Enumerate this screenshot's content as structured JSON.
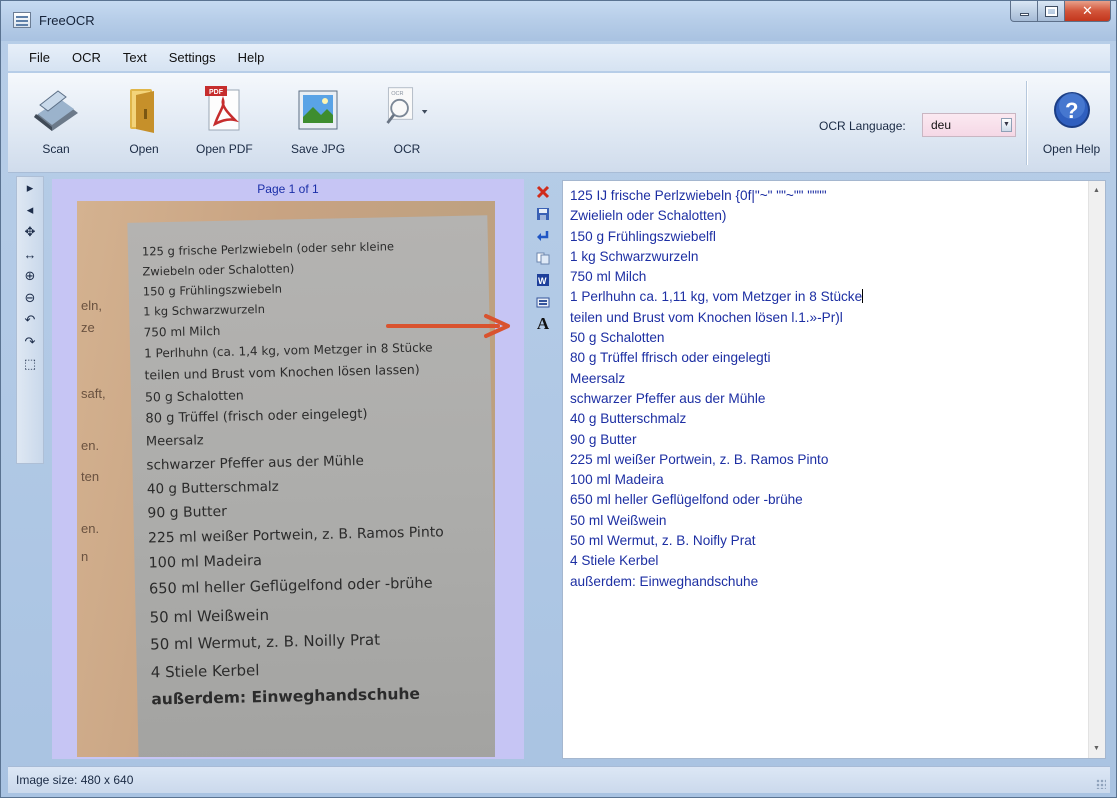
{
  "window": {
    "title": "FreeOCR"
  },
  "menu": {
    "items": [
      "File",
      "OCR",
      "Text",
      "Settings",
      "Help"
    ]
  },
  "toolbar": {
    "scan_label": "Scan",
    "open_label": "Open",
    "open_pdf_label": "Open PDF",
    "save_jpg_label": "Save JPG",
    "ocr_label": "OCR",
    "ocr_language_label": "OCR Language:",
    "ocr_language_value": "deu",
    "open_help_label": "Open Help"
  },
  "image_panel": {
    "page_label": "Page 1 of 1",
    "left_edge_text": [
      "eln,",
      "ze",
      "saft,",
      "en.",
      "ten",
      "en.",
      "n"
    ],
    "recipe_lines": [
      "125 g frische Perlzwiebeln (oder sehr kleine",
      "Zwiebeln oder Schalotten)",
      "150 g Frühlingszwiebeln",
      "1 kg Schwarzwurzeln",
      "750 ml Milch",
      "1 Perlhuhn (ca. 1,4 kg, vom Metzger in 8 Stücke",
      "teilen und Brust vom Knochen lösen lassen)",
      "50 g Schalotten",
      "80 g Trüffel (frisch oder eingelegt)",
      "Meersalz",
      "schwarzer Pfeffer aus der Mühle",
      "40 g Butterschmalz",
      "90 g Butter",
      "225 ml weißer Portwein, z. B. Ramos Pinto",
      "100 ml Madeira",
      "650 ml heller Geflügelfond oder -brühe",
      "50 ml Weißwein",
      "50 ml Wermut, z. B. Noilly Prat",
      "4 Stiele Kerbel",
      "außerdem: Einweghandschuhe"
    ]
  },
  "ocr_text": {
    "lines": [
      "125 IJ frische Perlzwiebeln {0f|\"~\" \"\"~\"\" \"\"\"\"",
      "Zwielieln oder Schalotten)",
      "150 g Frühlingszwiebelfl",
      "1 kg Schwarzwurzeln",
      "750 ml Milch",
      "1 Perlhuhn ca. 1,11 kg, vom Metzger in 8 Stücke",
      "teilen und Brust vom Knochen lösen l.1.»-Pr)l",
      "50 g Schalotten",
      "80 g Trüffel ffrisch oder eingelegti",
      "Meersalz",
      "schwarzer Pfeffer aus der Mühle",
      "40 g Butterschmalz",
      "90 g Butter",
      "225 ml weißer Portwein, z. B. Ramos Pinto",
      "100 ml Madeira",
      "650 ml heller Geflügelfond oder -brühe",
      "50 ml Weißwein",
      "50 ml Wermut, z. B. Noifly Prat",
      "4 Stiele Kerbel",
      "außerdem: Einweghandschuhe"
    ]
  },
  "status": {
    "image_size": "Image size: 480 x 640"
  },
  "colors": {
    "ocr_text": "#1d2fa3",
    "page_label": "#1a2ea8",
    "annotation_arrow": "#d9532f",
    "image_panel_bg": "#c6c5f4"
  }
}
